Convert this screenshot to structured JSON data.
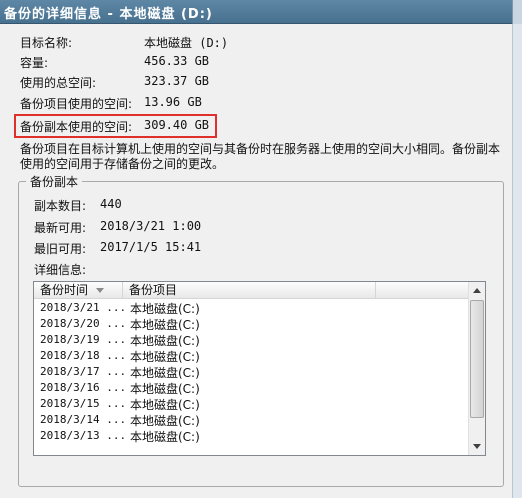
{
  "window": {
    "title": "备份的详细信息 - 本地磁盘 (D:)"
  },
  "info": [
    {
      "label": "目标名称:",
      "value": "本地磁盘 (D:)"
    },
    {
      "label": "容量:",
      "value": "456.33 GB"
    },
    {
      "label": "使用的总空间:",
      "value": "323.37 GB"
    },
    {
      "label": "备份项目使用的空间:",
      "value": "13.96 GB"
    },
    {
      "label": "备份副本使用的空间:",
      "value": "309.40 GB"
    }
  ],
  "description": "备份项目在目标计算机上使用的空间与其备份时在服务器上使用的空间大小相同。备份副本使用的空间用于存储备份之间的更改。",
  "group": {
    "legend": "备份副本",
    "count_label": "副本数目:",
    "count_value": "440",
    "latest_label": "最新可用:",
    "latest_value": "2018/3/21 1:00",
    "oldest_label": "最旧可用:",
    "oldest_value": "2017/1/5 15:41",
    "details_label": "详细信息:"
  },
  "table": {
    "columns": [
      "备份时间",
      "备份项目"
    ],
    "rows": [
      {
        "time": "2018/3/21 ...",
        "item": "本地磁盘(C:)"
      },
      {
        "time": "2018/3/20 ...",
        "item": "本地磁盘(C:)"
      },
      {
        "time": "2018/3/19 ...",
        "item": "本地磁盘(C:)"
      },
      {
        "time": "2018/3/18 ...",
        "item": "本地磁盘(C:)"
      },
      {
        "time": "2018/3/17 ...",
        "item": "本地磁盘(C:)"
      },
      {
        "time": "2018/3/16 ...",
        "item": "本地磁盘(C:)"
      },
      {
        "time": "2018/3/15 ...",
        "item": "本地磁盘(C:)"
      },
      {
        "time": "2018/3/14 ...",
        "item": "本地磁盘(C:)"
      },
      {
        "time": "2018/3/13 ...",
        "item": "本地磁盘(C:)"
      }
    ]
  },
  "colors": {
    "highlight": "#e0302b",
    "titlebar": "#5f87a6"
  }
}
